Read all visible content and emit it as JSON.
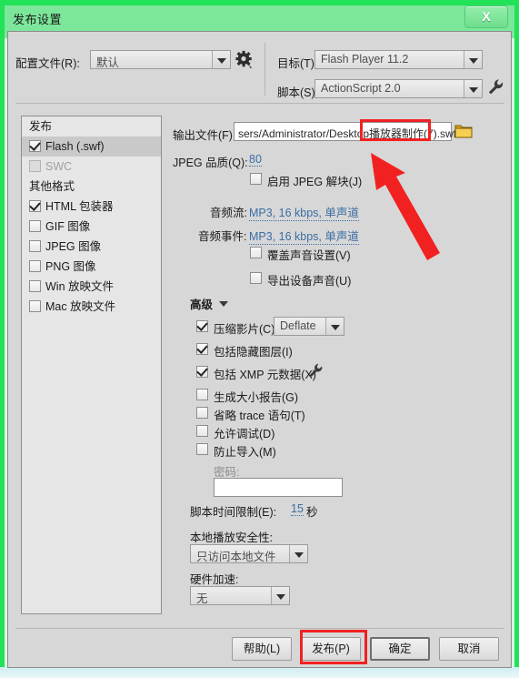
{
  "window": {
    "title": "发布设置",
    "close_label": "X",
    "accent_green": "#22e257"
  },
  "top": {
    "profile_label": "配置文件(R):",
    "profile_value": "默认",
    "gear_icon": "gear-icon",
    "target_label": "目标(T):",
    "target_value": "Flash Player 11.2",
    "script_label": "脚本(S):",
    "script_value": "ActionScript 2.0",
    "wrench_icon": "wrench-icon"
  },
  "sidebar": {
    "groups": [
      {
        "label": "发布",
        "items": [
          {
            "label": "Flash (.swf)",
            "checked": true,
            "selected": true,
            "disabled": false
          },
          {
            "label": "SWC",
            "checked": false,
            "selected": false,
            "disabled": true
          }
        ]
      },
      {
        "label": "其他格式",
        "items": [
          {
            "label": "HTML 包装器",
            "checked": true,
            "selected": false,
            "disabled": false
          },
          {
            "label": "GIF 图像",
            "checked": false,
            "selected": false,
            "disabled": false
          },
          {
            "label": "JPEG 图像",
            "checked": false,
            "selected": false,
            "disabled": false
          },
          {
            "label": "PNG 图像",
            "checked": false,
            "selected": false,
            "disabled": false
          },
          {
            "label": "Win 放映文件",
            "checked": false,
            "selected": false,
            "disabled": false
          },
          {
            "label": "Mac 放映文件",
            "checked": false,
            "selected": false,
            "disabled": false
          }
        ]
      }
    ]
  },
  "main": {
    "output_label": "输出文件(F):",
    "output_path_prefix": "sers/Administrator/Desktop",
    "output_path_highlight": "播放器制作(7)",
    "output_path_suffix": ".swf",
    "folder_icon": "folder-icon",
    "jpeg_quality_label": "JPEG 品质(Q):",
    "jpeg_quality_value": "80",
    "enable_deblock_label": "启用 JPEG 解块(J)",
    "enable_deblock_checked": false,
    "audio_stream_label": "音频流:",
    "audio_stream_value": "MP3, 16 kbps, 单声道",
    "audio_event_label": "音频事件:",
    "audio_event_value": "MP3, 16 kbps, 单声道",
    "override_sound_label": "覆盖声音设置(V)",
    "override_sound_checked": false,
    "export_device_sound_label": "导出设备声音(U)",
    "export_device_sound_checked": false,
    "advanced_label": "高级",
    "advanced_arrow": "chevron-down-icon",
    "compress_movie_label": "压缩影片(C)",
    "compress_movie_checked": true,
    "compress_movie_value": "Deflate",
    "include_hidden_layers_label": "包括隐藏图层(I)",
    "include_hidden_layers_checked": true,
    "include_xmp_label": "包括 XMP 元数据(X)",
    "include_xmp_checked": true,
    "xmp_wrench_icon": "wrench-icon",
    "size_report_label": "生成大小报告(G)",
    "size_report_checked": false,
    "omit_trace_label": "省略 trace 语句(T)",
    "omit_trace_checked": false,
    "permit_debug_label": "允许调试(D)",
    "permit_debug_checked": false,
    "protect_import_label": "防止导入(M)",
    "protect_import_checked": false,
    "password_label": "密码:",
    "password_value": "",
    "script_time_label": "脚本时间限制(E):",
    "script_time_value": "15",
    "script_time_unit": "秒",
    "local_playback_label": "本地播放安全性:",
    "local_playback_value": "只访问本地文件",
    "hardware_accel_label": "硬件加速:",
    "hardware_accel_value": "无"
  },
  "footer": {
    "help_label": "帮助(L)",
    "publish_label": "发布(P)",
    "ok_label": "确定",
    "cancel_label": "取消"
  },
  "annotations": {
    "highlight_color": "#f22121",
    "arrow_icon": "red-arrow-icon",
    "highlight_filename_box": "播放器制作(7)",
    "highlight_publish_box": "发布(P)"
  }
}
